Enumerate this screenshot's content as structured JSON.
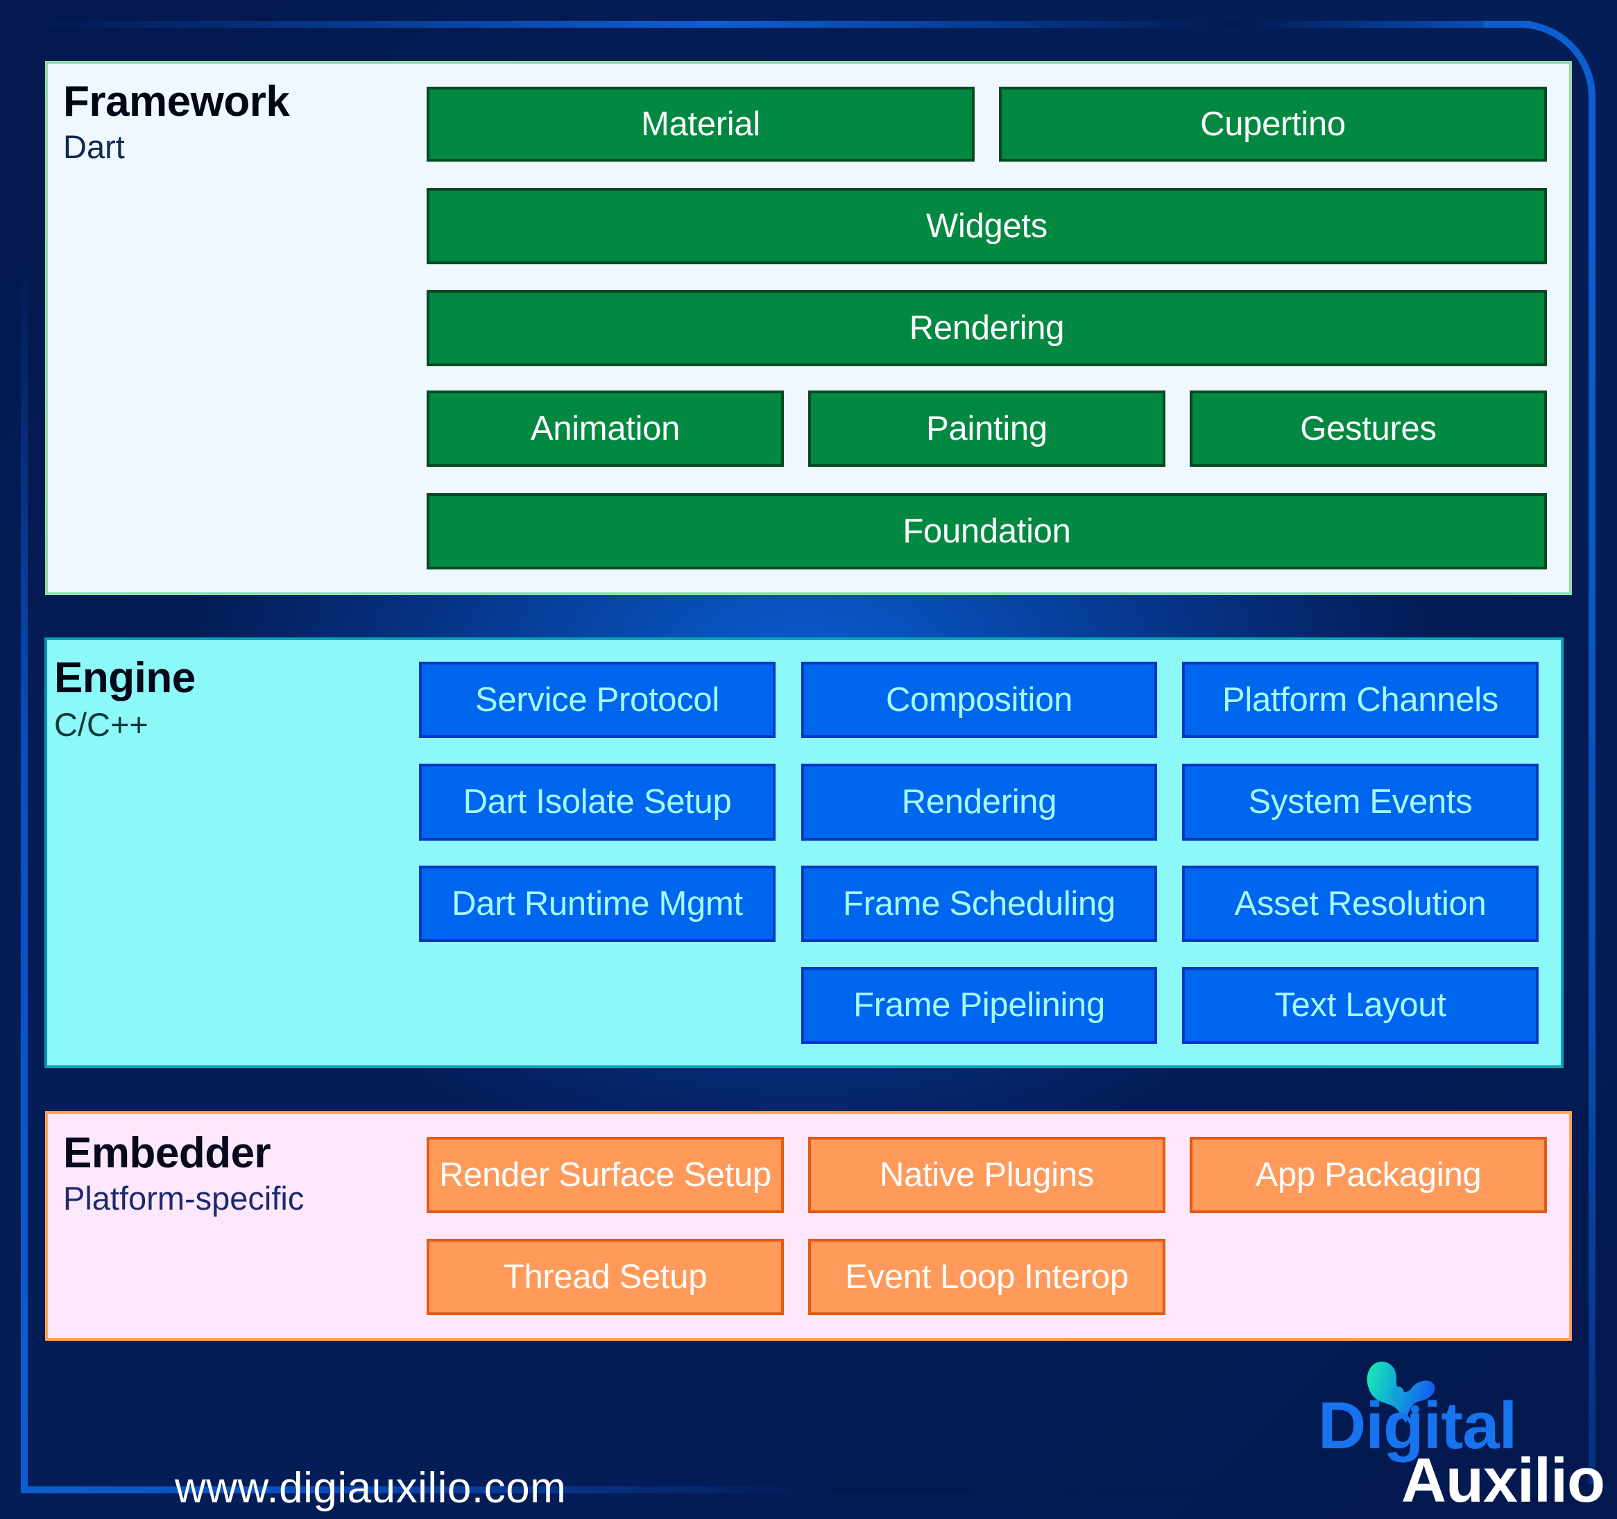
{
  "layers": {
    "framework": {
      "title": "Framework",
      "subtitle": "Dart",
      "color": "#028841",
      "rows": [
        [
          "Material",
          "Cupertino"
        ],
        [
          "Widgets"
        ],
        [
          "Rendering"
        ],
        [
          "Animation",
          "Painting",
          "Gestures"
        ],
        [
          "Foundation"
        ]
      ]
    },
    "engine": {
      "title": "Engine",
      "subtitle": "C/C++",
      "color": "#0066ee",
      "rows": [
        [
          "Service Protocol",
          "Composition",
          "Platform Channels"
        ],
        [
          "Dart Isolate Setup",
          "Rendering",
          "System Events"
        ],
        [
          "Dart Runtime Mgmt",
          "Frame Scheduling",
          "Asset Resolution"
        ],
        [
          "",
          "Frame Pipelining",
          "Text Layout"
        ]
      ]
    },
    "embedder": {
      "title": "Embedder",
      "subtitle": "Platform-specific",
      "color": "#ff9a5a",
      "rows": [
        [
          "Render Surface Setup",
          "Native Plugins",
          "App Packaging"
        ],
        [
          "Thread Setup",
          "Event Loop Interop"
        ]
      ]
    }
  },
  "footer": {
    "url": "www.digiauxilio.com"
  },
  "logo": {
    "line1": "Digital",
    "line2": "Auxilio",
    "icon": "splash-blob-icon"
  }
}
